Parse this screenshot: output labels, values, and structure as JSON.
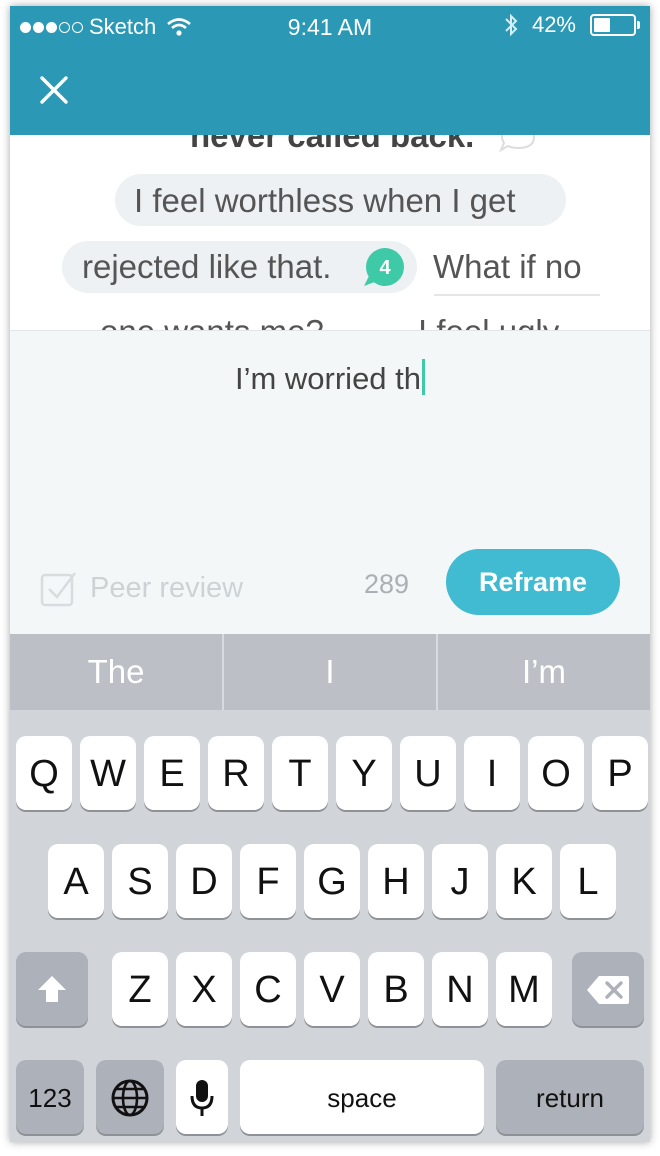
{
  "status_bar": {
    "carrier": "Sketch",
    "time": "9:41 AM",
    "battery": "42%"
  },
  "thought": {
    "line0": "never called back.",
    "line1": "I feel worthless when I get",
    "line2a": "rejected like that.",
    "comment_count": "4",
    "line2b": "What if no",
    "line3a": "one wants me?",
    "line3b": "I feel ugly."
  },
  "composer": {
    "draft": "I’m worried th",
    "peer_review_label": "Peer review",
    "peer_review_checked": false,
    "char_count": "289",
    "reframe_label": "Reframe"
  },
  "keyboard": {
    "suggestions": [
      "The",
      "I",
      "I’m"
    ],
    "row1": [
      "Q",
      "W",
      "E",
      "R",
      "T",
      "Y",
      "U",
      "I",
      "O",
      "P"
    ],
    "row2": [
      "A",
      "S",
      "D",
      "F",
      "G",
      "H",
      "J",
      "K",
      "L"
    ],
    "row3": [
      "Z",
      "X",
      "C",
      "V",
      "B",
      "N",
      "M"
    ],
    "numbers_label": "123",
    "space_label": "space",
    "return_label": "return"
  },
  "colors": {
    "header": "#2b99b6",
    "reframe": "#40bbd1",
    "accent_green": "#3ec9a7"
  }
}
